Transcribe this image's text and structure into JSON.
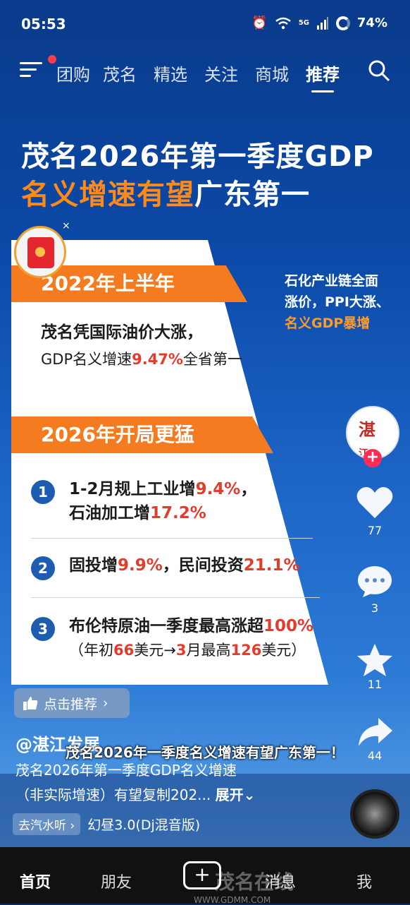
{
  "status": {
    "time": "05:53",
    "network": "5G",
    "battery": "74%"
  },
  "nav": {
    "tabs": [
      "团购",
      "茂名",
      "精选",
      "关注",
      "商城",
      "推荐"
    ],
    "active": "推荐"
  },
  "headline": {
    "line1": "茂名2026年第一季度GDP",
    "line2_orange": "名义增速有望",
    "line2_white": "广东第一"
  },
  "section1": {
    "title": "2022年上半年",
    "line1": "茂名凭国际油价大涨，",
    "line2_a": "GDP名义增速",
    "line2_b": "9.47%",
    "line2_c": "全省第一"
  },
  "right_note": {
    "line1": "石化产业链全面",
    "line2": "涨价，PPI大涨、",
    "line3": "名义GDP暴增"
  },
  "section2": {
    "title": "2026年开局更猛",
    "items": [
      {
        "num": "1",
        "a1": "1-2月规上工业增",
        "b1": "9.4%",
        "c1": "，",
        "a2": "石油加工增",
        "b2": "17.2%"
      },
      {
        "num": "2",
        "a1": "固投增",
        "b1": "9.9%",
        "c1": "，民间投资",
        "d1": "21.1%"
      },
      {
        "num": "3",
        "a1": "布伦特原油一季度最高涨超",
        "b1": "100%",
        "s1": "（年初",
        "s2": "66",
        "s3": "美元→",
        "s4": "3",
        "s5": "月最高",
        "s6": "126",
        "s7": "美元）"
      }
    ]
  },
  "recommend": {
    "label": "点击推荐"
  },
  "side": {
    "likes": "77",
    "comments": "3",
    "favorites": "11",
    "shares": "44",
    "avatar_text": "湛江发展"
  },
  "author": "@湛江发展",
  "caption": "茂名2026年一季度名义增速有望广东第一！",
  "desc": {
    "line1": "茂名2026年第一季度GDP名义增速",
    "line2": "（非实际增速）有望复制202...",
    "more": "展开"
  },
  "music": {
    "tag": "去汽水听",
    "title": "幻昼3.0(Dj混音版)"
  },
  "bottom_nav": {
    "home": "首页",
    "friends": "朋友",
    "messages": "消息",
    "me": "我"
  },
  "watermark": {
    "text": "茂名在线",
    "url": "WWW.GDMM.COM"
  }
}
